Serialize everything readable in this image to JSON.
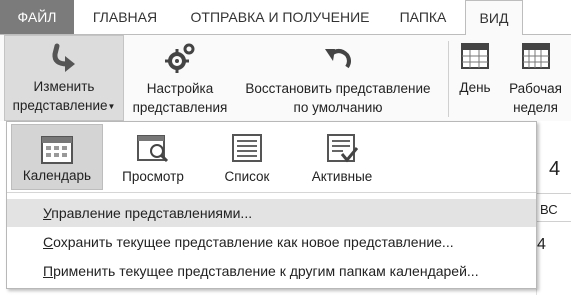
{
  "tabs": {
    "file": "ФАЙЛ",
    "home": "ГЛАВНАЯ",
    "send_receive": "ОТПРАВКА И ПОЛУЧЕНИЕ",
    "folder": "ПАПКА",
    "view": "ВИД"
  },
  "ribbon": {
    "change_view": {
      "line1": "Изменить",
      "line2": "представление"
    },
    "view_settings": {
      "line1": "Настройка",
      "line2": "представления"
    },
    "reset_view": {
      "line1": "Восстановить представление",
      "line2": "по умолчанию"
    },
    "day": {
      "line1": "День"
    },
    "work_week": {
      "line1": "Рабочая",
      "line2": "неделя"
    }
  },
  "gallery": [
    {
      "label": "Календарь",
      "icon": "calendar-view-icon",
      "selected": true
    },
    {
      "label": "Просмотр",
      "icon": "preview-view-icon",
      "selected": false
    },
    {
      "label": "Список",
      "icon": "list-view-icon",
      "selected": false
    },
    {
      "label": "Активные",
      "icon": "active-view-icon",
      "selected": false
    }
  ],
  "menu": {
    "manage": {
      "accel": "У",
      "rest": "правление представлениями..."
    },
    "save_as": {
      "accel": "С",
      "rest": "охранить текущее представление как новое представление..."
    },
    "apply": {
      "accel": "П",
      "rest": "рименить текущее представление к другим папкам календарей..."
    }
  },
  "background": {
    "num1": "4",
    "day_abbr": "ВС",
    "num2": "4"
  }
}
